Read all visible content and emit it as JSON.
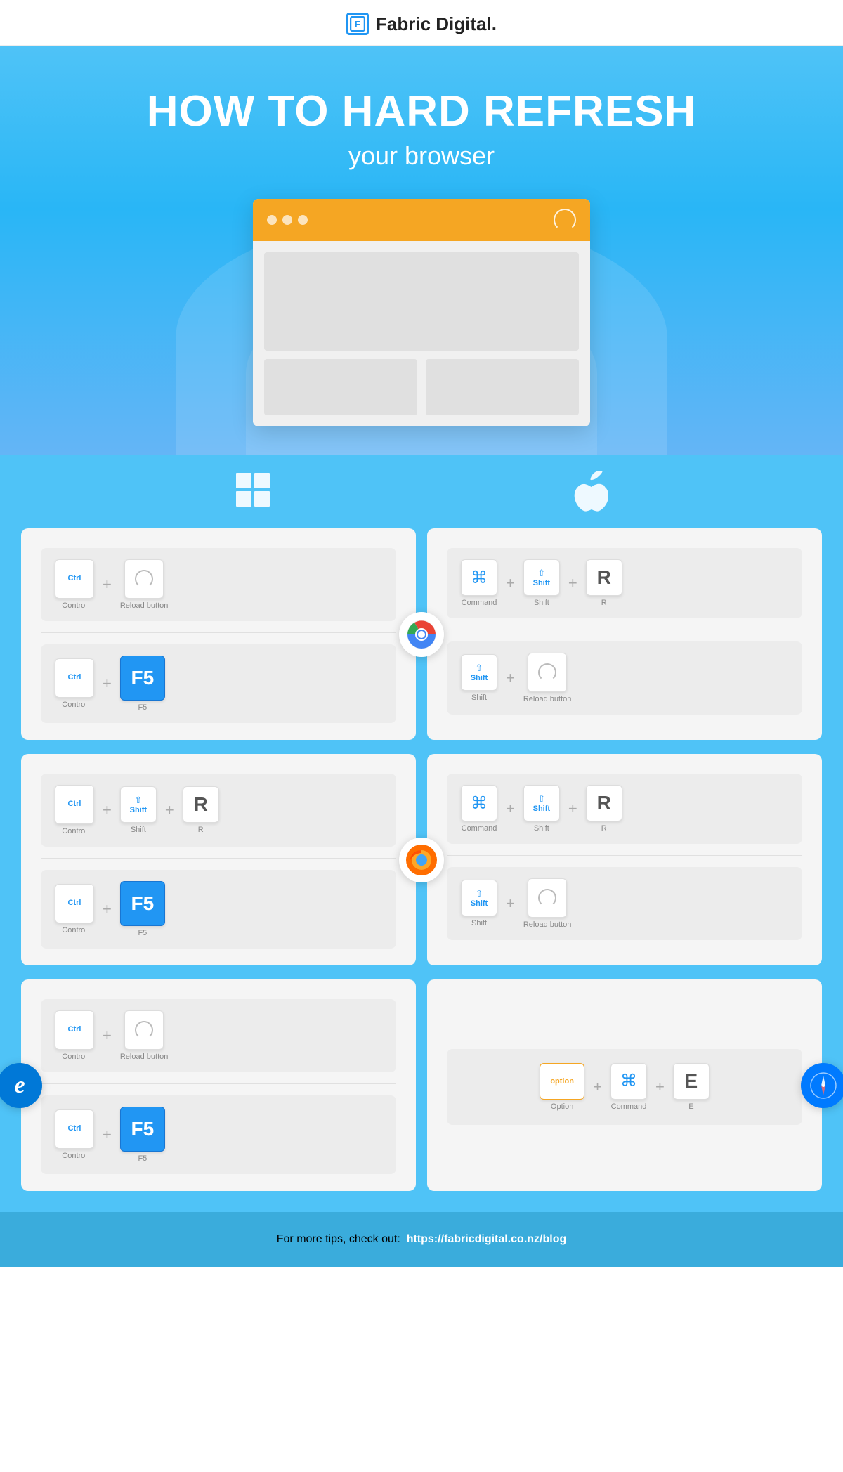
{
  "header": {
    "logo_text": "Fabric Digital.",
    "logo_icon": "F"
  },
  "hero": {
    "title": "HOW TO HARD REFRESH",
    "subtitle": "your browser"
  },
  "os": {
    "windows_label": "Windows",
    "mac_label": "Mac"
  },
  "chrome": {
    "name": "Chrome",
    "windows": {
      "row1": {
        "keys": [
          "Ctrl",
          "Reload button"
        ],
        "labels": [
          "Control",
          "Reload button"
        ]
      },
      "row2": {
        "keys": [
          "Ctrl",
          "F5"
        ],
        "labels": [
          "Control",
          "F5"
        ]
      }
    },
    "mac": {
      "row1": {
        "keys": [
          "⌘",
          "Shift",
          "R"
        ],
        "labels": [
          "Command",
          "Shift",
          "R"
        ]
      },
      "row2": {
        "keys": [
          "Shift",
          "Reload button"
        ],
        "labels": [
          "Shift",
          "Reload button"
        ]
      }
    }
  },
  "firefox": {
    "name": "Firefox",
    "windows": {
      "row1": {
        "keys": [
          "Ctrl",
          "Shift",
          "R"
        ],
        "labels": [
          "Control",
          "Shift",
          "R"
        ]
      },
      "row2": {
        "keys": [
          "Ctrl",
          "F5"
        ],
        "labels": [
          "Control",
          "F5"
        ]
      }
    },
    "mac": {
      "row1": {
        "keys": [
          "⌘",
          "Shift",
          "R"
        ],
        "labels": [
          "Command",
          "Shift",
          "R"
        ]
      },
      "row2": {
        "keys": [
          "Shift",
          "Reload button"
        ],
        "labels": [
          "Shift",
          "Reload button"
        ]
      }
    }
  },
  "ie": {
    "name": "IE",
    "windows": {
      "row1": {
        "keys": [
          "Ctrl",
          "Reload button"
        ],
        "labels": [
          "Control",
          "Reload button"
        ]
      },
      "row2": {
        "keys": [
          "Ctrl",
          "F5"
        ],
        "labels": [
          "Control",
          "F5"
        ]
      }
    }
  },
  "safari": {
    "name": "Safari",
    "mac": {
      "row1": {
        "keys": [
          "option",
          "⌘",
          "E"
        ],
        "labels": [
          "Option",
          "Command",
          "E"
        ]
      }
    }
  },
  "footer": {
    "text": "For more tips, check out:",
    "link": "https://fabricdigital.co.nz/blog"
  }
}
